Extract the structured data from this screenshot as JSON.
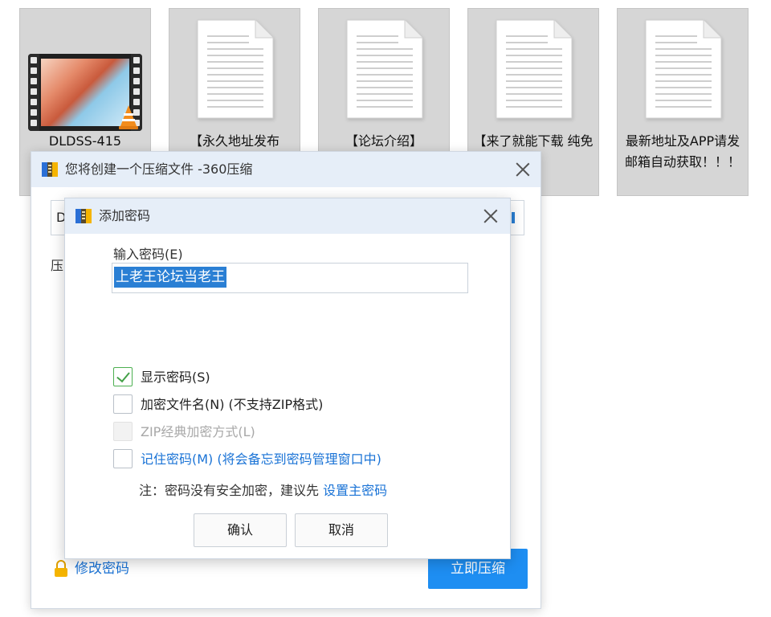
{
  "desktop": {
    "files": [
      {
        "name": "DLDSS-415",
        "type": "video"
      },
      {
        "name": "【永久地址发布",
        "type": "document"
      },
      {
        "name": "【论坛介绍】",
        "type": "document"
      },
      {
        "name": "【来了就能下载 纯免 】",
        "type": "document"
      },
      {
        "name": "最新地址及APP请发邮箱自动获取！！！",
        "type": "document"
      }
    ]
  },
  "main_window": {
    "title": "您将创建一个压缩文件 -360压缩",
    "path_value": "D",
    "label2": "压",
    "change_password_link": "修改密码",
    "compress_button": "立即压缩"
  },
  "dialog": {
    "title": "添加密码",
    "password_label": "输入密码(E)",
    "password_value": "上老王论坛当老王",
    "options": [
      {
        "label": "显示密码(S)",
        "checked": true,
        "disabled": false,
        "style": "normal"
      },
      {
        "label": "加密文件名(N) (不支持ZIP格式)",
        "checked": false,
        "disabled": false,
        "style": "normal"
      },
      {
        "label": "ZIP经典加密方式(L)",
        "checked": false,
        "disabled": true,
        "style": "disabled"
      },
      {
        "label": "记住密码(M) (将会备忘到密码管理窗口中)",
        "checked": false,
        "disabled": false,
        "style": "link"
      }
    ],
    "note_prefix": "注：密码没有安全加密，建议先",
    "note_link": "设置主密码",
    "ok_button": "确认",
    "cancel_button": "取消"
  },
  "colors": {
    "titlebar": "#e6eef8",
    "link": "#1a73d6",
    "primary_button": "#1e8ef2",
    "selection": "#2a7fd4"
  }
}
